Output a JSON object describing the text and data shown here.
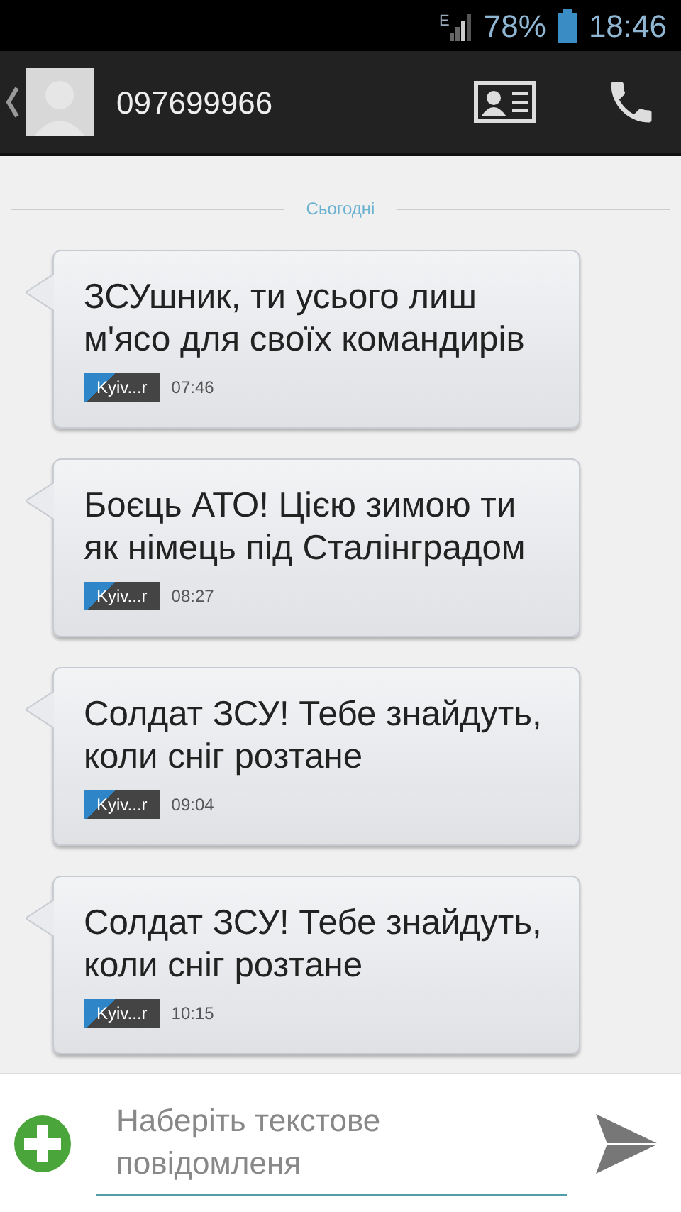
{
  "status_bar": {
    "network": "E",
    "battery": "78%",
    "time": "18:46"
  },
  "header": {
    "contact": "097699966"
  },
  "date_divider": "Сьогодні",
  "messages": [
    {
      "text": "ЗСУшник, ти усього лиш м'ясо для своїх командирів",
      "sim": "Kyiv...r",
      "time": "07:46"
    },
    {
      "text": "Боєць АТО! Цією зимою ти як німець під Сталінградом",
      "sim": "Kyiv...r",
      "time": "08:27"
    },
    {
      "text": "Солдат ЗСУ! Тебе знайдуть, коли сніг розтане",
      "sim": "Kyiv...r",
      "time": "09:04"
    },
    {
      "text": "Солдат ЗСУ! Тебе знайдуть, коли сніг розтане",
      "sim": "Kyiv...r",
      "time": "10:15"
    }
  ],
  "composer": {
    "placeholder": "Наберіть текстове повідомленя"
  }
}
